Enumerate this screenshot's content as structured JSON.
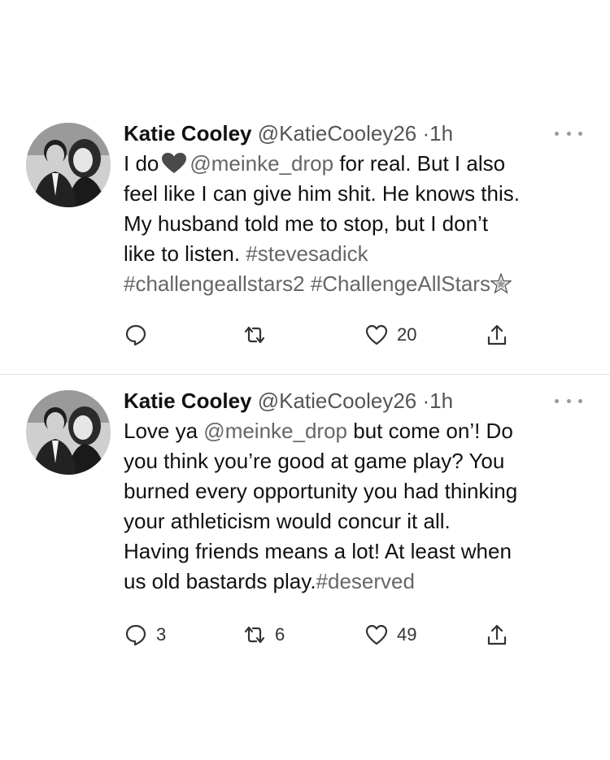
{
  "tweets": [
    {
      "author_name": "Katie Cooley",
      "handle": "@KatieCooley26",
      "separator": "·",
      "time": "1h",
      "body": {
        "line1_a": "I do",
        "line1_mention": "@meinke_drop",
        "line1_b": " for real. But I also",
        "line2": "feel like I can give him shit. He knows this.",
        "line3": "My husband told me to stop, but I don’t",
        "line4_a": "like to listen. ",
        "line4_tag": "#stevesadick",
        "line5_tag1": "#challengeallstars2",
        "line5_tag2": " #ChallengeAllStars"
      },
      "emoji": [
        "black-heart-emoji",
        "star-emoji"
      ],
      "actions": {
        "replies": "",
        "retweets": "",
        "likes": "20"
      }
    },
    {
      "author_name": "Katie Cooley",
      "handle": "@KatieCooley26",
      "separator": "·",
      "time": "1h",
      "body": {
        "line1_a": "Love ya ",
        "line1_mention": "@meinke_drop",
        "line1_b": " but come on’! Do",
        "line2": "you think you’re good at game play? You",
        "line3": "burned every opportunity you had thinking",
        "line4": "your athleticism would concur it all.",
        "line5": "Having friends means a lot! At least when",
        "line6_a": "us old bastards play.",
        "line6_tag": "#deserved"
      },
      "actions": {
        "replies": "3",
        "retweets": "6",
        "likes": "49"
      }
    }
  ],
  "icons": [
    "avatar-photo",
    "more-options-icon",
    "reply-icon",
    "retweet-icon",
    "like-icon",
    "share-icon"
  ],
  "colors": {
    "text": "#111111",
    "muted": "#555555",
    "link": "#666666",
    "divider": "#e3e3e3"
  }
}
